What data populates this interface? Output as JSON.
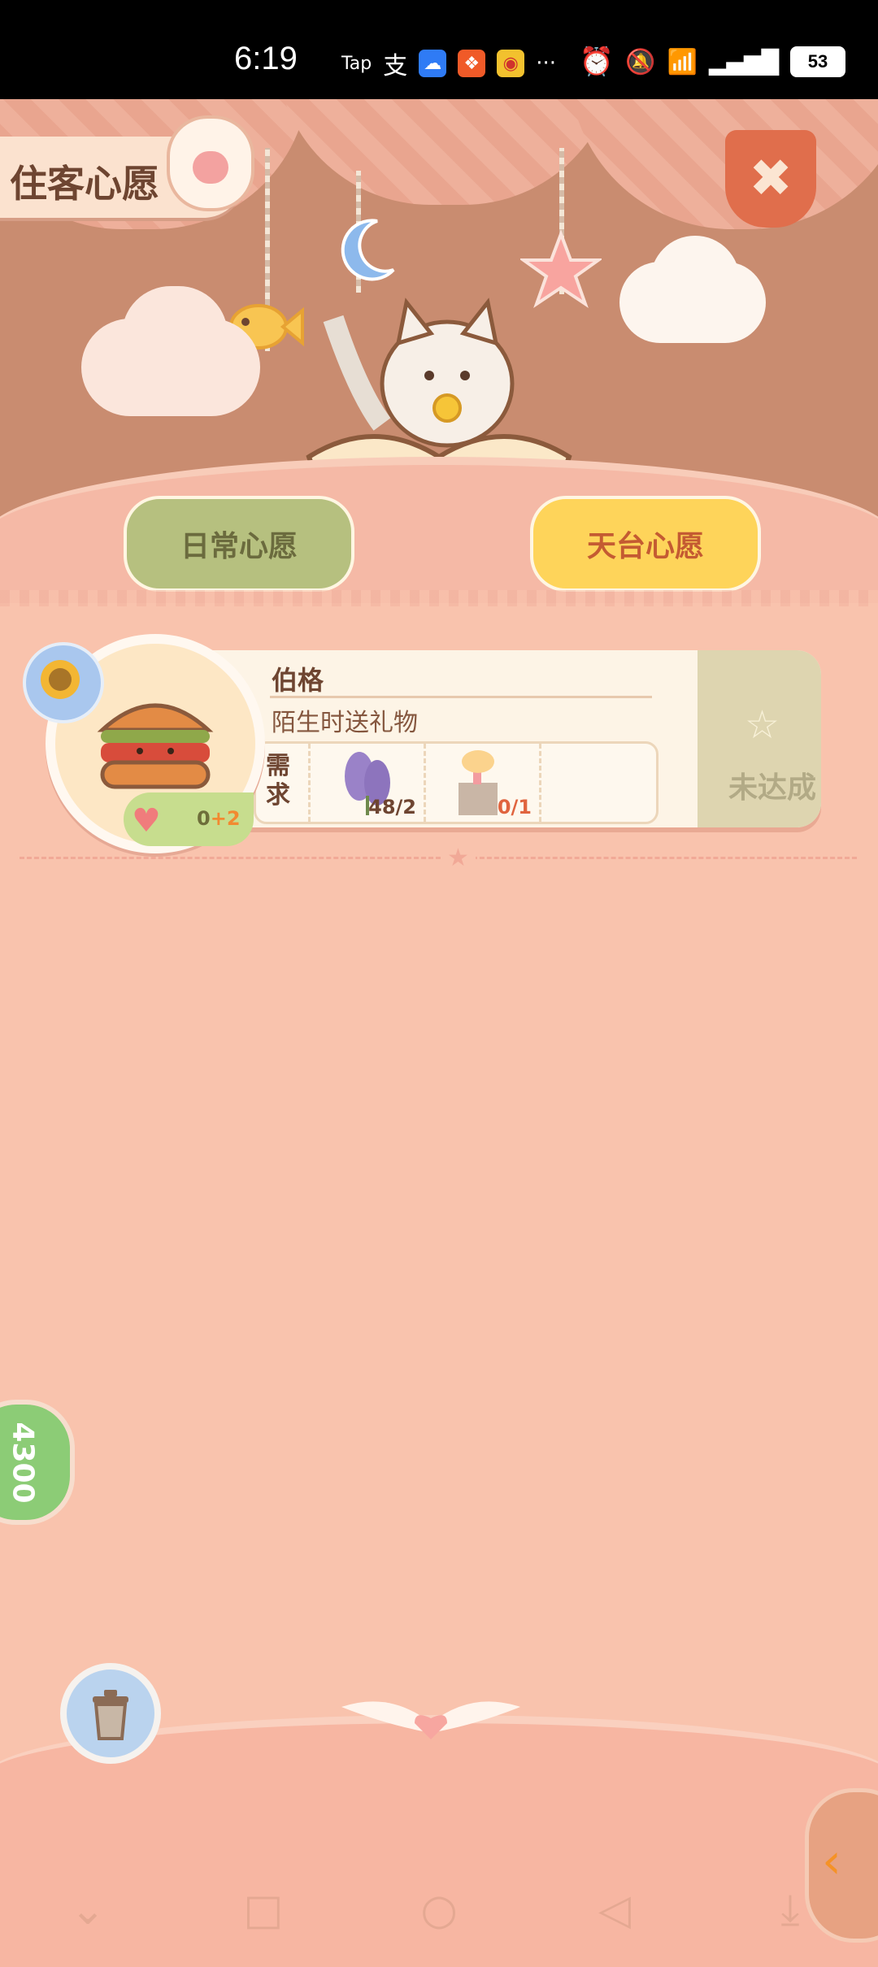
{
  "status_bar": {
    "time": "6:19",
    "app_icons": [
      "Tap",
      "支",
      "cloud",
      "ks",
      "weibo",
      "···"
    ],
    "battery": "53"
  },
  "header": {
    "title": "住客心愿",
    "close_icon": "close-icon"
  },
  "tabs": [
    {
      "label": "日常心愿",
      "active": false
    },
    {
      "label": "天台心愿",
      "active": true
    }
  ],
  "wishes": [
    {
      "name": "伯格",
      "description": "陌生时送礼物",
      "need_label": "需求",
      "requirements": [
        {
          "icon": "lavender-icon",
          "count": "48/2",
          "count_color": "#6e4531"
        },
        {
          "icon": "cat-lamp-icon",
          "count": "0/1",
          "count_color": "#e0643f"
        }
      ],
      "status": "未达成",
      "heart_value": "0",
      "heart_bonus": "+2"
    }
  ],
  "side_bubble": {
    "value": "4300"
  },
  "nav": [
    "⌄",
    "□",
    "○",
    "◁",
    "⤓"
  ],
  "colors": {
    "background": "#f9c3ad",
    "tab_active": "#fed45a",
    "tab_inactive": "#b6c07f",
    "status_pending": "#ded5b0"
  }
}
